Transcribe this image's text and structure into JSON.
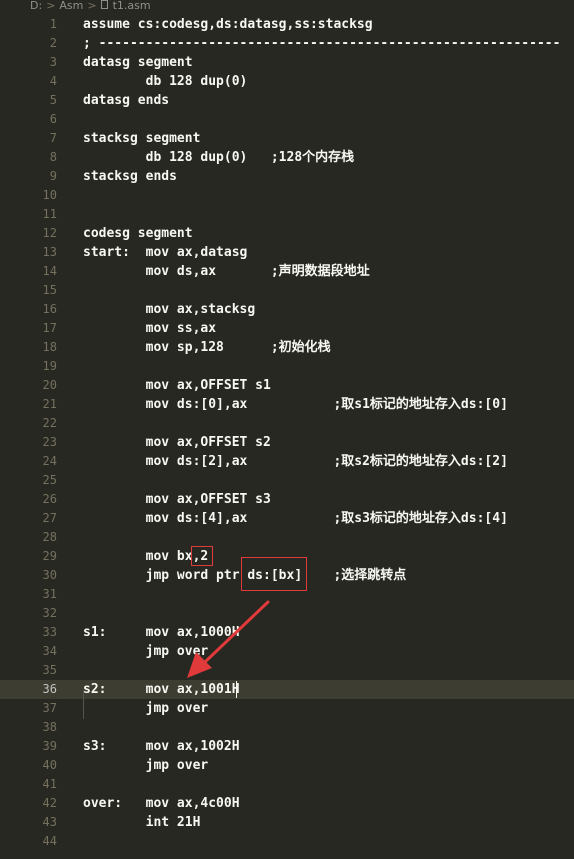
{
  "breadcrumb": {
    "drive": "D:",
    "folder": "Asm",
    "file": "t1.asm"
  },
  "editor": {
    "current_line": 36,
    "lines": [
      {
        "n": "1",
        "text": "assume cs:codesg,ds:datasg,ss:stacksg"
      },
      {
        "n": "2",
        "text": "; -----------------------------------------------------------"
      },
      {
        "n": "3",
        "text": "datasg segment"
      },
      {
        "n": "4",
        "text": "        db 128 dup(0)"
      },
      {
        "n": "5",
        "text": "datasg ends"
      },
      {
        "n": "6",
        "text": ""
      },
      {
        "n": "7",
        "text": "stacksg segment"
      },
      {
        "n": "8",
        "text": "        db 128 dup(0)   ;128个内存栈"
      },
      {
        "n": "9",
        "text": "stacksg ends"
      },
      {
        "n": "10",
        "text": ""
      },
      {
        "n": "11",
        "text": ""
      },
      {
        "n": "12",
        "text": "codesg segment"
      },
      {
        "n": "13",
        "text": "start:  mov ax,datasg"
      },
      {
        "n": "14",
        "text": "        mov ds,ax       ;声明数据段地址"
      },
      {
        "n": "15",
        "text": ""
      },
      {
        "n": "16",
        "text": "        mov ax,stacksg"
      },
      {
        "n": "17",
        "text": "        mov ss,ax"
      },
      {
        "n": "18",
        "text": "        mov sp,128      ;初始化栈"
      },
      {
        "n": "19",
        "text": ""
      },
      {
        "n": "20",
        "text": "        mov ax,OFFSET s1"
      },
      {
        "n": "21",
        "text": "        mov ds:[0],ax           ;取s1标记的地址存入ds:[0]"
      },
      {
        "n": "22",
        "text": ""
      },
      {
        "n": "23",
        "text": "        mov ax,OFFSET s2"
      },
      {
        "n": "24",
        "text": "        mov ds:[2],ax           ;取s2标记的地址存入ds:[2]"
      },
      {
        "n": "25",
        "text": ""
      },
      {
        "n": "26",
        "text": "        mov ax,OFFSET s3"
      },
      {
        "n": "27",
        "text": "        mov ds:[4],ax           ;取s3标记的地址存入ds:[4]"
      },
      {
        "n": "28",
        "text": ""
      },
      {
        "n": "29",
        "text": "        mov bx,2"
      },
      {
        "n": "30",
        "text": "        jmp word ptr ds:[bx]    ;选择跳转点"
      },
      {
        "n": "31",
        "text": ""
      },
      {
        "n": "32",
        "text": ""
      },
      {
        "n": "33",
        "text": "s1:     mov ax,1000H"
      },
      {
        "n": "34",
        "text": "        jmp over"
      },
      {
        "n": "35",
        "text": ""
      },
      {
        "n": "36",
        "text": "s2:     mov ax,1001H"
      },
      {
        "n": "37",
        "text": "        jmp over"
      },
      {
        "n": "38",
        "text": ""
      },
      {
        "n": "39",
        "text": "s3:     mov ax,1002H"
      },
      {
        "n": "40",
        "text": "        jmp over"
      },
      {
        "n": "41",
        "text": ""
      },
      {
        "n": "42",
        "text": "over:   mov ax,4c00H"
      },
      {
        "n": "43",
        "text": "        int 21H"
      },
      {
        "n": "44",
        "text": ""
      }
    ]
  },
  "annotations": {
    "box_color": "#e03a3a",
    "arrow_color": "#e03a3a"
  }
}
